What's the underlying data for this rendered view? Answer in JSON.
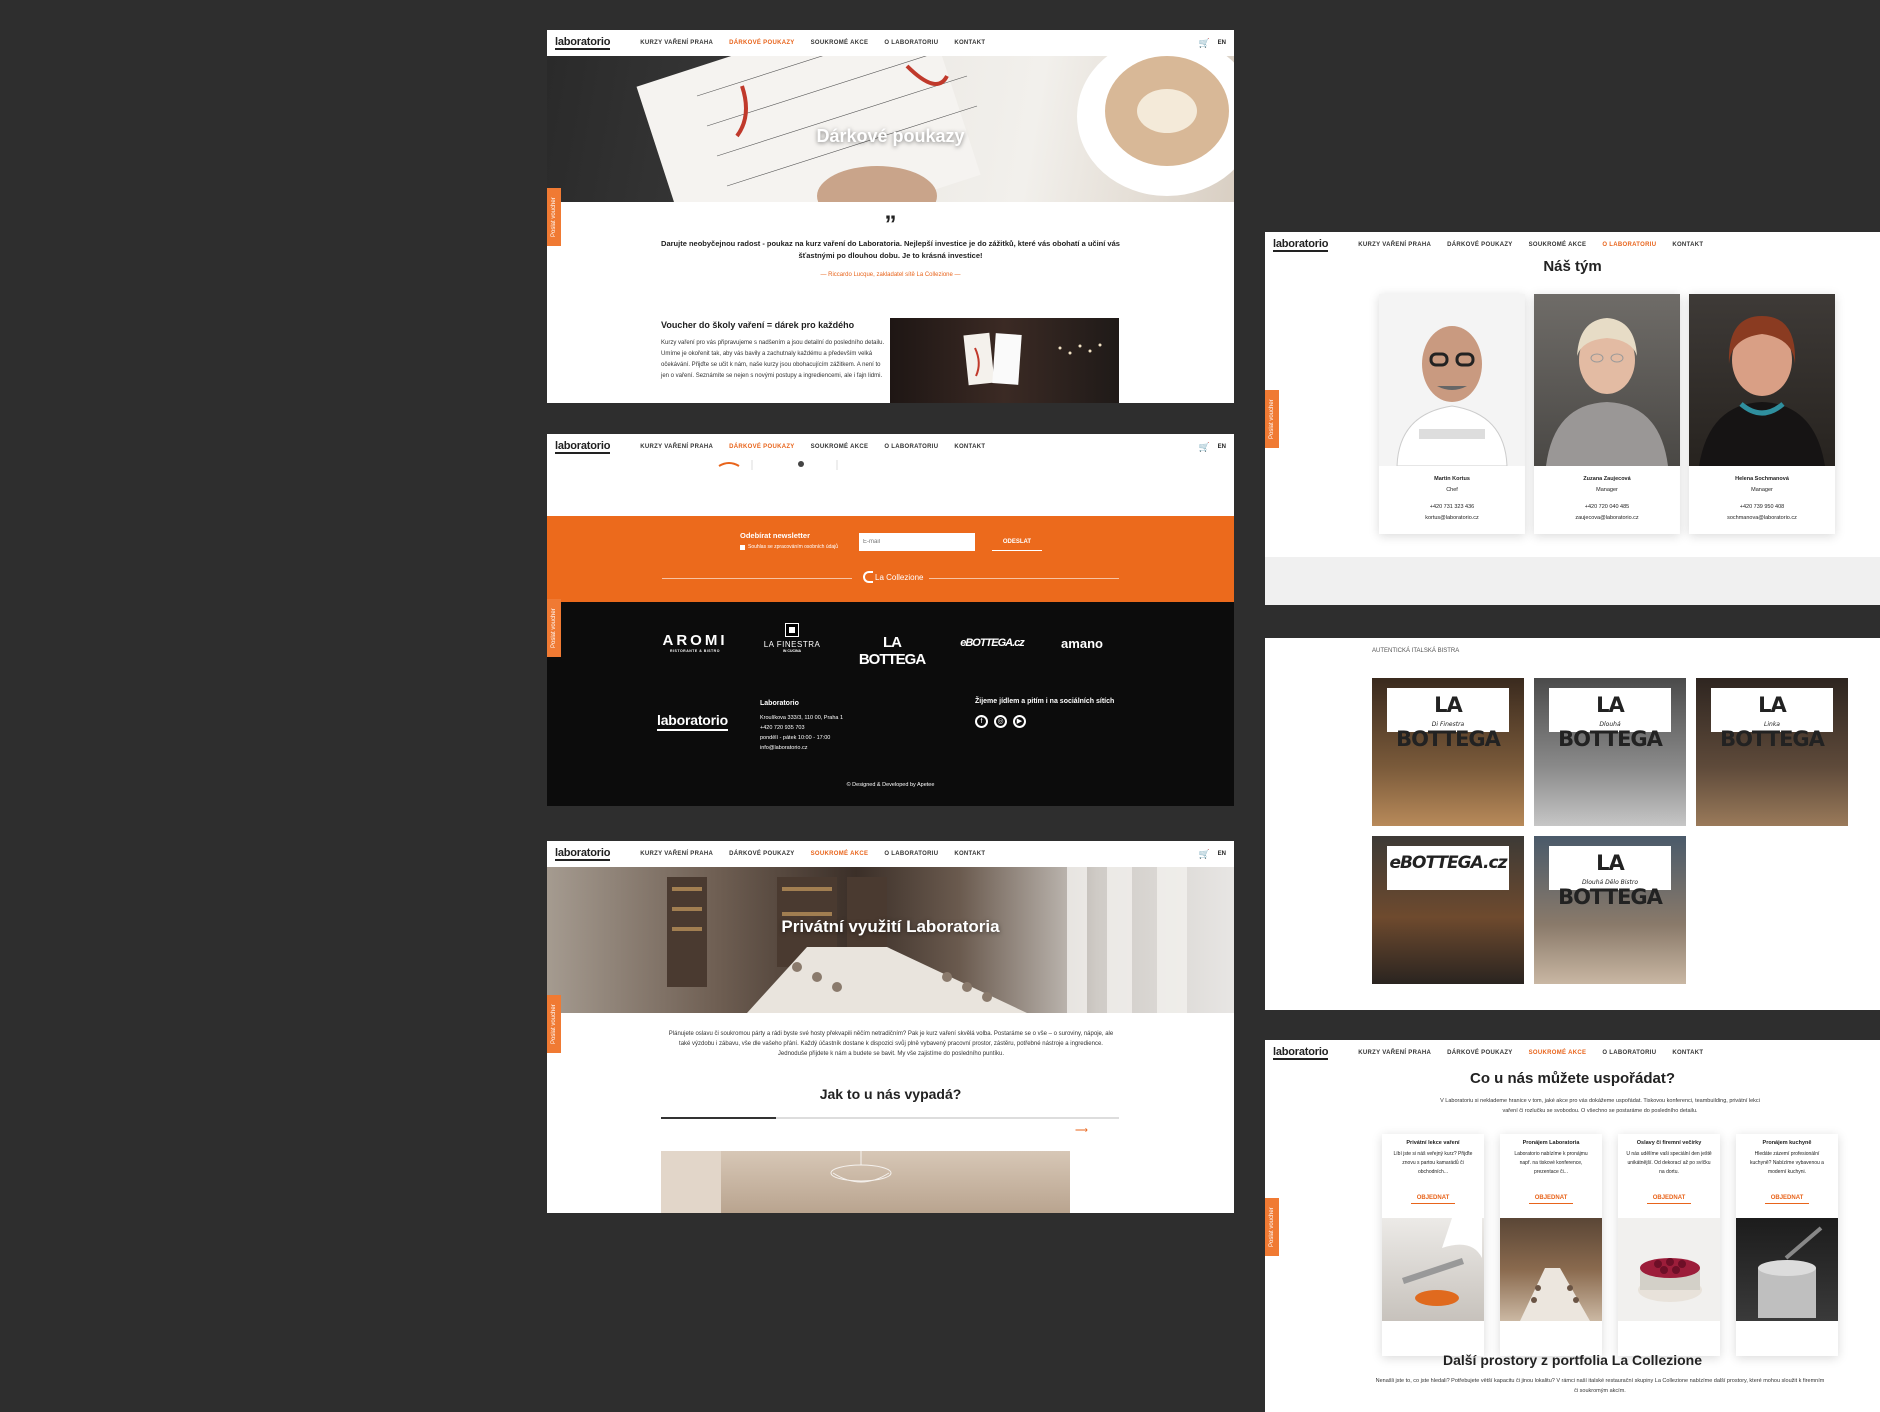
{
  "nav": {
    "logo": "laboratorio",
    "links": [
      "KURZY VAŘENÍ PRAHA",
      "DÁRKOVÉ POUKAZY",
      "SOUKROMÉ AKCE",
      "O LABORATORIU",
      "KONTAKT"
    ],
    "lang": "EN",
    "cart_icon": "cart-icon"
  },
  "side_tab": "Poslat voucher",
  "vouchers": {
    "hero_title": "Dárkové poukazy",
    "quote_mark": "”",
    "quote": "Darujte neobyčejnou radost - poukaz na kurz vaření do Laboratoria. Nejlepší investice je do zážitků, které vás obohatí a učiní vás šťastnými po dlouhou dobu. Je to krásná investice!",
    "quote_author": "— Riccardo Lucque, zakladatel sítě La Collezione —",
    "section_title": "Voucher do školy vaření = dárek pro každého",
    "section_text": "Kurzy vaření pro vás připravujeme s nadšením a jsou detailní do posledního detailu. Umíme je okořenit tak, aby vás bavily a zachutnaly každému a  především velká očekávání. Přijďte se učit k nám, naše kurzy jsou obohacujícím zážitkem. A není to jen o vaření. Seznámíte se nejen s novými postupy a ingrediencemi, ale i fajn lidmi."
  },
  "newsletter": {
    "title": "Odebírat newsletter",
    "consent": "Souhlas se zpracováním osobních údajů",
    "placeholder": "E-mail",
    "button": "ODESLAT",
    "divider_logo": "La Collezione"
  },
  "footer": {
    "brands": [
      "AROMI",
      "LA FINESTRA",
      "LA BOTTEGA",
      "eBOTTEGA.cz",
      "amano"
    ],
    "brand_subs": [
      "RISTORANTE & BISTRO",
      "IN CUCINA",
      "",
      ""
    ],
    "company": "Laboratorio",
    "address": "Kroulíkova 333/3, 110 00, Praha 1",
    "phone": "+420 720 935 703",
    "hours": "pondělí - pátek 10:00 - 17:00",
    "email": "info@laboratorio.cz",
    "social_title": "Žijeme jídlem a pitím i na sociálních sítích",
    "social": [
      "f",
      "◎",
      "▶"
    ],
    "credits": "© Designed & Developed by Apetee"
  },
  "private": {
    "hero_title": "Privátní využití Laboratoria",
    "text": "Plánujete oslavu či soukromou párty a rádi byste své hosty překvapili něčím netradičním? Pak je kurz vaření skvělá volba. Postaráme se o vše – o suroviny, nápoje, ale také výzdobu i zábavu, vše dle vašeho přání. Každý účastník dostane k dispozici svůj plně vybavený pracovní prostor, zástěru, potřebné nástroje a ingredience. Jednoduše přijdete k nám a budete se bavit. My vše zajistíme do posledního puntíku.",
    "subtitle": "Jak to u nás vypadá?"
  },
  "team": {
    "title": "Náš tým",
    "members": [
      {
        "name": "Martin Kortus",
        "role": "Chef",
        "phone": "+420 731 323 436",
        "email": "kortus@laboratorio.cz"
      },
      {
        "name": "Zuzana Zaujecová",
        "role": "Manager",
        "phone": "+420 720 040 485",
        "email": "zaujecova@laboratorio.cz"
      },
      {
        "name": "Helena Sochmanová",
        "role": "Manager",
        "phone": "+420 739 950 408",
        "email": "sochmanova@laboratorio.cz"
      }
    ]
  },
  "bistros": {
    "label": "AUTENTICKÁ ITALSKÁ BISTRA",
    "items": [
      {
        "name": "LA BOTTEGA",
        "sub": "Di Finestra"
      },
      {
        "name": "LA BOTTEGA",
        "sub": "Dlouhá"
      },
      {
        "name": "LA BOTTEGA",
        "sub": "Linka"
      },
      {
        "name": "eBOTTEGA.cz",
        "sub": ""
      },
      {
        "name": "LA BOTTEGA",
        "sub": "Dlouhá Dělo Bistro"
      }
    ]
  },
  "events": {
    "title": "Co u nás můžete uspořádat?",
    "intro": "V Laboratoriu si neklademe hranice v tom, jaké akce pro vás dokážeme uspořádat. Tiskovou konferenci, teambuilding, privátní lekci vaření či rozlučku se svobodou. O všechno se postaráme do posledního detailu.",
    "cards": [
      {
        "title": "Privátní lekce vaření",
        "text": "Líbí jste si náš veřejný kurz? Přijďte znovu s partou kamarádů či obchodních...",
        "button": "OBJEDNAT"
      },
      {
        "title": "Pronájem Laboratoria",
        "text": "Laboratorio nabízíme k pronájmu např. na tiskové konference, prezentace či...",
        "button": "OBJEDNAT"
      },
      {
        "title": "Oslavy či firemní večírky",
        "text": "U nás udělíme vaši speciální den ještě unikátnější. Od dekorací až po svíčku na dortu.",
        "button": "OBJEDNAT"
      },
      {
        "title": "Pronájem kuchyně",
        "text": "Hledáte zázemí profesionální kuchyně? Nabízíme vybavenou a moderní kuchyni.",
        "button": "OBJEDNAT"
      }
    ],
    "portfolio_title": "Další prostory z portfolia La Collezione",
    "portfolio_text": "Nenašli jste to, co jste hledali? Potřebujete větší kapacitu či jinou lokalitu? V rámci naší italské restaurační skupiny La Collezione nabízíme další prostory, které mohou sloužit k firemním či soukromým akcím."
  },
  "colors": {
    "accent": "#e8641b",
    "background": "#2e2e2e",
    "footer": "#0c0c0c"
  }
}
